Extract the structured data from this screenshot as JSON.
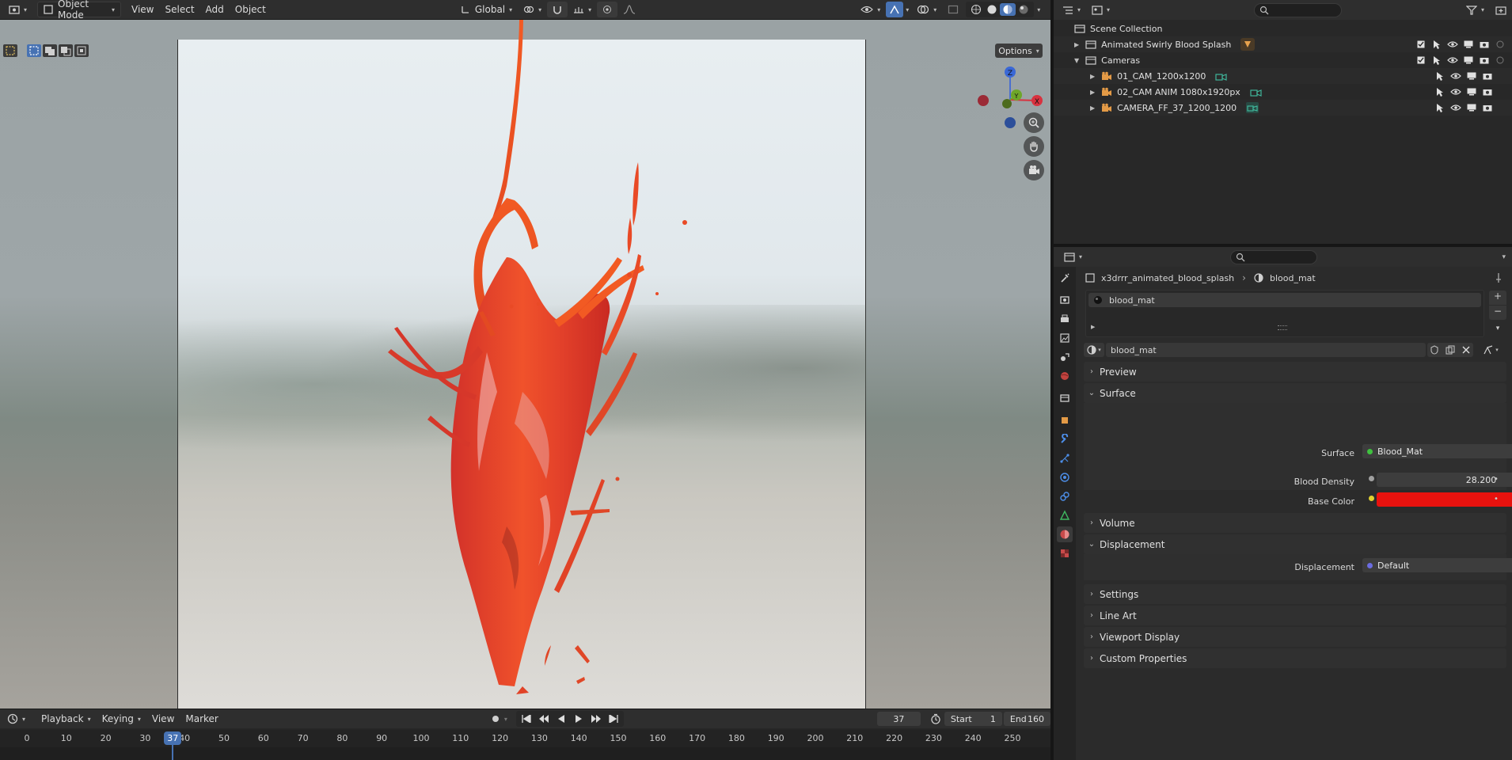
{
  "header": {
    "mode_label": "Object Mode",
    "menus": [
      "View",
      "Select",
      "Add",
      "Object"
    ],
    "transform_orientation": "Global"
  },
  "viewport": {
    "options_label": "Options",
    "gizmo": {
      "z": "Z",
      "x": "X",
      "y": "Y"
    },
    "colors": {
      "blood": "#e8431e",
      "blood_dark": "#c4291b"
    }
  },
  "timeline": {
    "menus": [
      "Playback",
      "Keying",
      "View",
      "Marker"
    ],
    "current_frame": "37",
    "start_label": "Start",
    "start_value": "1",
    "end_label": "End",
    "end_value": "160",
    "ticks": [
      "0",
      "10",
      "20",
      "30",
      "40",
      "50",
      "60",
      "70",
      "80",
      "90",
      "100",
      "110",
      "120",
      "130",
      "140",
      "150",
      "160",
      "170",
      "180",
      "190",
      "200",
      "210",
      "220",
      "230",
      "240",
      "250"
    ],
    "playhead_label": "37"
  },
  "outliner": {
    "root": "Scene Collection",
    "items": [
      {
        "label": "Animated Swirly Blood Splash",
        "depth": 0
      },
      {
        "label": "Cameras",
        "depth": 0
      },
      {
        "label": "01_CAM_1200x1200",
        "depth": 1
      },
      {
        "label": "02_CAM ANIM 1080x1920px",
        "depth": 1
      },
      {
        "label": "CAMERA_FF_37_1200_1200",
        "depth": 1
      }
    ]
  },
  "properties": {
    "breadcrumb_object": "x3drrr_animated_blood_splash",
    "breadcrumb_material": "blood_mat",
    "slot_name": "blood_mat",
    "material_name": "blood_mat",
    "panels": {
      "preview": "Preview",
      "surface": "Surface",
      "volume": "Volume",
      "displacement": "Displacement",
      "settings": "Settings",
      "line_art": "Line Art",
      "viewport_display": "Viewport Display",
      "custom_properties": "Custom Properties"
    },
    "surface_label": "Surface",
    "surface_value": "Blood_Mat",
    "blood_density_label": "Blood Density",
    "blood_density_value": "28.200",
    "base_color_label": "Base Color",
    "base_color": "#e8120e",
    "displacement_label": "Displacement",
    "displacement_value": "Default"
  }
}
